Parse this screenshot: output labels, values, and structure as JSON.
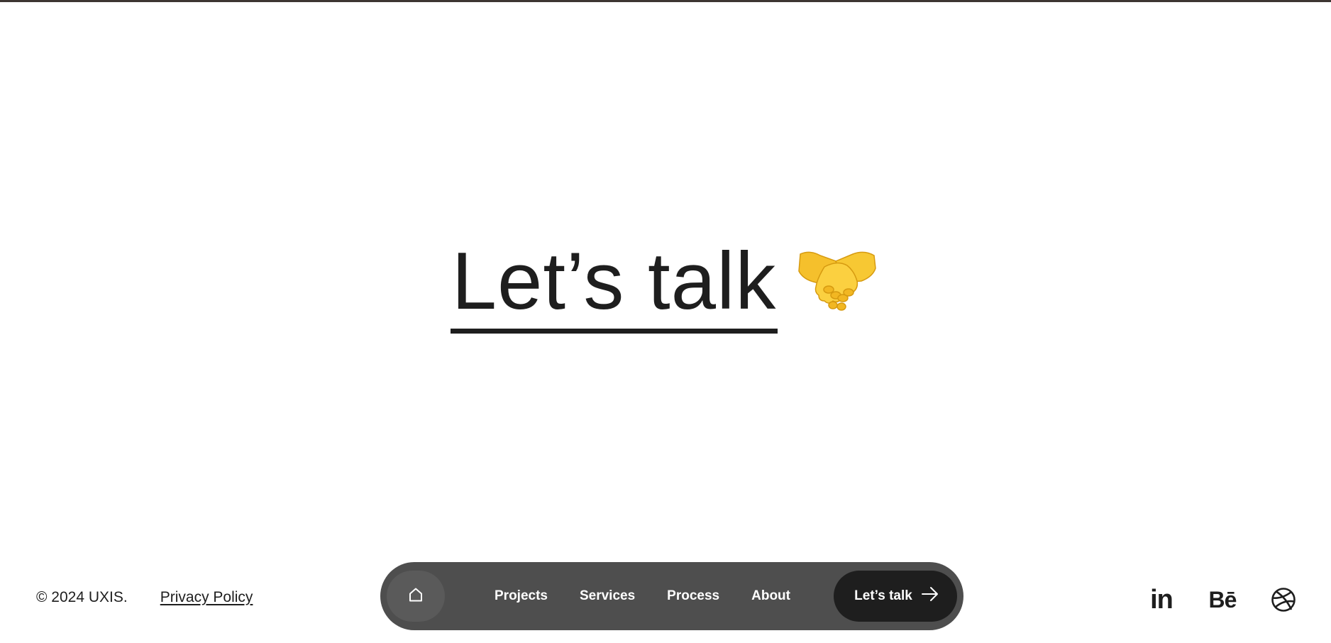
{
  "hero": {
    "title": "Let’s talk",
    "emoji": "handshake"
  },
  "footer": {
    "copyright": "© 2024 UXIS.",
    "privacy_label": "Privacy Policy"
  },
  "nav": {
    "home_icon": "home-icon",
    "items": [
      {
        "label": "Projects"
      },
      {
        "label": "Services"
      },
      {
        "label": "Process"
      },
      {
        "label": "About"
      }
    ],
    "cta_label": "Let’s talk",
    "cta_icon": "arrow-right-icon"
  },
  "socials": {
    "linkedin_label": "in",
    "behance_label": "Bē",
    "dribbble_icon": "dribbble-icon"
  },
  "colors": {
    "text": "#1e1e1e",
    "nav_bg": "#4e4e4e",
    "home_bg": "#5a5a5a",
    "cta_bg": "#1e1e1e",
    "top_bar": "#3d3531",
    "emoji_yellow": "#f7c530"
  }
}
